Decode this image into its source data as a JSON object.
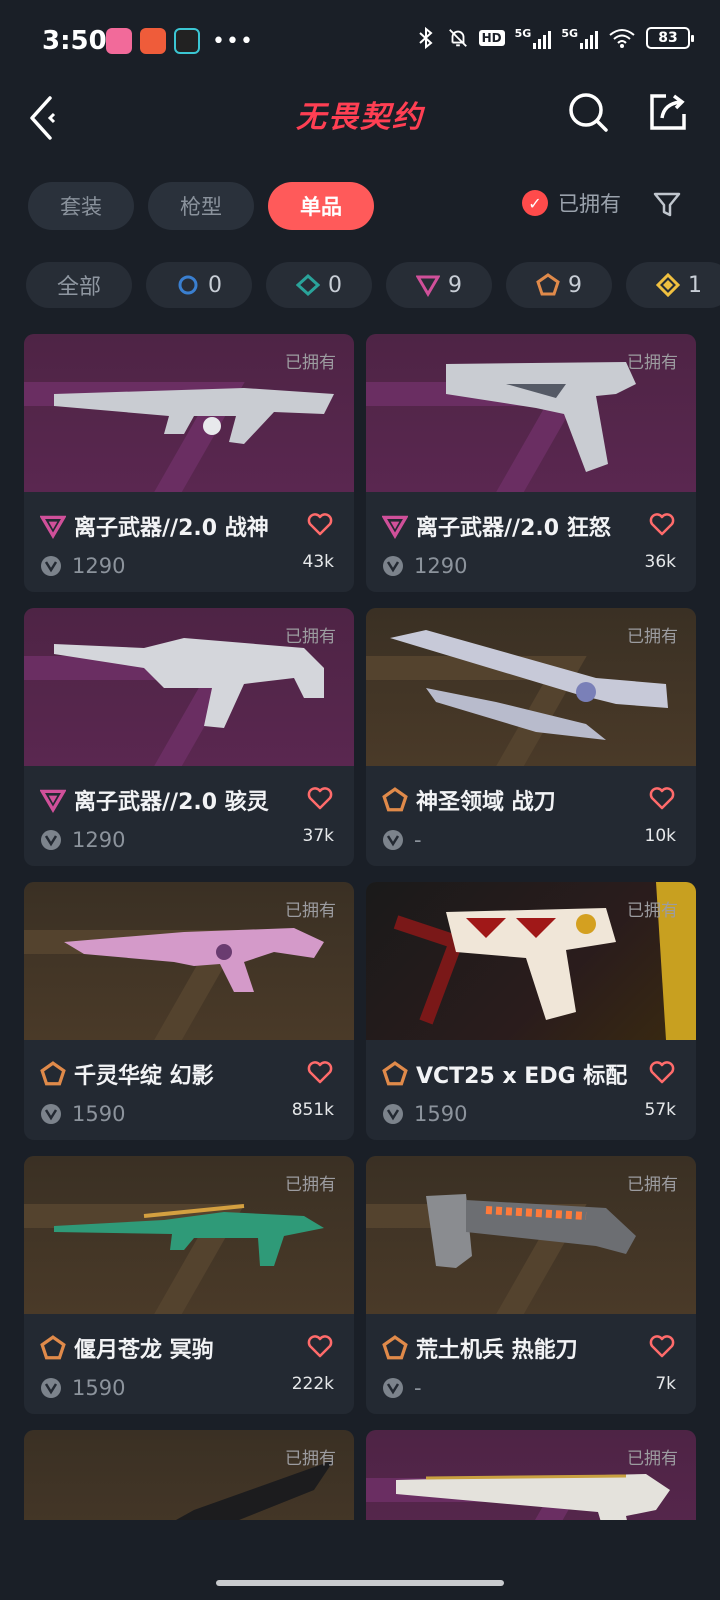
{
  "status_bar": {
    "time": "3:50",
    "hd_label": "HD",
    "net1": "5G",
    "net2": "5G",
    "battery": "83"
  },
  "header": {
    "logo_text": "无畏契约"
  },
  "tabs": [
    {
      "label": "套装",
      "active": false
    },
    {
      "label": "枪型",
      "active": false
    },
    {
      "label": "单品",
      "active": true
    }
  ],
  "owned_filter": {
    "label": "已拥有",
    "checked": true
  },
  "chips": [
    {
      "label": "全部"
    },
    {
      "count": "0",
      "tier": "select"
    },
    {
      "count": "0",
      "tier": "deluxe"
    },
    {
      "count": "9",
      "tier": "premium"
    },
    {
      "count": "9",
      "tier": "exclusive"
    },
    {
      "count": "1",
      "tier": "ultra"
    }
  ],
  "items": [
    {
      "name": "离子武器//2.0 战神",
      "price": "1290",
      "likes": "43k",
      "owned": "已拥有",
      "tier": "premium",
      "bg": "purple"
    },
    {
      "name": "离子武器//2.0 狂怒",
      "price": "1290",
      "likes": "36k",
      "owned": "已拥有",
      "tier": "premium",
      "bg": "purple"
    },
    {
      "name": "离子武器//2.0 骇灵",
      "price": "1290",
      "likes": "37k",
      "owned": "已拥有",
      "tier": "premium",
      "bg": "purple"
    },
    {
      "name": "神圣领域 战刀",
      "price": "-",
      "likes": "10k",
      "owned": "已拥有",
      "tier": "exclusive",
      "bg": "brown"
    },
    {
      "name": "千灵华绽 幻影",
      "price": "1590",
      "likes": "851k",
      "owned": "已拥有",
      "tier": "exclusive",
      "bg": "brown"
    },
    {
      "name": "VCT25 x EDG 标配",
      "price": "1590",
      "likes": "57k",
      "owned": "已拥有",
      "tier": "exclusive",
      "bg": "dark"
    },
    {
      "name": "偃月苍龙 冥驹",
      "price": "1590",
      "likes": "222k",
      "owned": "已拥有",
      "tier": "exclusive",
      "bg": "brown"
    },
    {
      "name": "荒土机兵 热能刀",
      "price": "-",
      "likes": "7k",
      "owned": "已拥有",
      "tier": "exclusive",
      "bg": "brown"
    },
    {
      "owned": "已拥有",
      "bg": "brown"
    },
    {
      "owned": "已拥有",
      "bg": "purple"
    }
  ],
  "colors": {
    "accent": "#ff5a5a",
    "premium": "#d0509a",
    "exclusive": "#e08a4a",
    "ultra": "#f0c040",
    "select": "#3a7fd0",
    "deluxe": "#2aa39a"
  }
}
